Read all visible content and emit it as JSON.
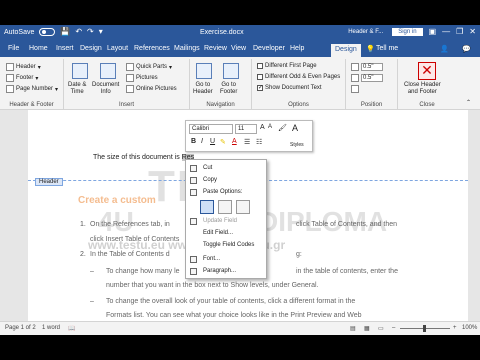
{
  "titlebar": {
    "autosave": "AutoSave",
    "autosave_state": "Off",
    "doc_title": "Exercise.docx",
    "context_label": "Header & F...",
    "signin": "Sign in",
    "min": "—",
    "restore": "❐",
    "close": "✕"
  },
  "tabs": [
    "File",
    "Home",
    "Insert",
    "Design",
    "Layout",
    "References",
    "Mailings",
    "Review",
    "View",
    "Developer",
    "Help",
    "Design",
    "Tell me"
  ],
  "ribbon": {
    "header": "Header",
    "footer": "Footer",
    "page_number": "Page Number",
    "group_hf": "Header & Footer",
    "date_time": "Date &\nTime",
    "doc_info": "Document\nInfo",
    "quick_parts": "Quick Parts",
    "pictures": "Pictures",
    "online_pictures": "Online Pictures",
    "group_insert": "Insert",
    "go_header": "Go to\nHeader",
    "go_footer": "Go to\nFooter",
    "group_nav": "Navigation",
    "opt1": "Different First Page",
    "opt2": "Different Odd & Even Pages",
    "opt3": "Show Document Text",
    "group_options": "Options",
    "pos1": "0.5\"",
    "pos2": "0.5\"",
    "group_position": "Position",
    "close_hf": "Close Header\nand Footer",
    "group_close": "Close"
  },
  "document": {
    "line1": "The size of this document is",
    "line1_sel": "Res",
    "header_tag": "Header",
    "heading": "Create a custom",
    "item1a": "On the References tab, in",
    "item1b": "click Table of Contents, and then",
    "item1c": "click Insert Table of Contents",
    "item2a": "In the Table of Contents d",
    "item2b": "g:",
    "item3a": "To change how many le",
    "item3b": "in the table of contents, enter the",
    "item3c": "number that you want in the box next to Show levels, under General.",
    "item4a": "To change the overall look of your table of contents, click a different format in the",
    "item4b": "Formats list. You can see what your choice looks like in the Print Preview and Web",
    "watermark1": "TEST",
    "watermark2": "DIPLOMA",
    "watermark3": "4U",
    "watermark_url": "www.testu.eu  www.diploma.edu.gr"
  },
  "minibar": {
    "font": "Calibri",
    "size": "11",
    "styles": "Styles"
  },
  "context_menu": {
    "cut": "Cut",
    "copy": "Copy",
    "paste_options": "Paste Options:",
    "update_field": "Update Field",
    "edit_field": "Edit Field...",
    "toggle_codes": "Toggle Field Codes",
    "font": "Font...",
    "paragraph": "Paragraph..."
  },
  "status": {
    "page": "Page 1 of 2",
    "words": "1 word",
    "zoom": "100%"
  },
  "colors": {
    "word_blue": "#2b579a",
    "ribbon_bg": "#f3f3f3",
    "heading_orange": "#f0a060"
  }
}
